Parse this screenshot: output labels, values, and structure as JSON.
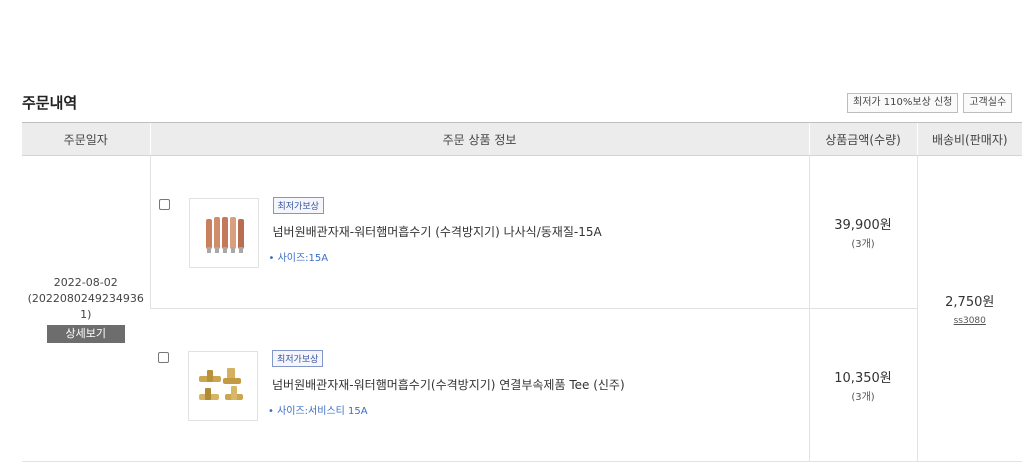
{
  "section": {
    "title": "주문내역",
    "buttons": [
      "최저가 110%보상 신청",
      "고객실수"
    ]
  },
  "table": {
    "headers": [
      "주문일자",
      "주문 상품 정보",
      "상품금액(수량)",
      "배송비(판매자)"
    ],
    "order": {
      "date": "2022-08-02",
      "order_number_line1": "(2022080249234936",
      "order_number_line2": "1)",
      "detail_label": "상세보기"
    },
    "items": [
      {
        "badge": "최저가보상",
        "name": "넘버원배관자재-워터햄머흡수기 (수격방지기) 나사식/동재질-15A",
        "option": "• 사이즈:15A",
        "price": "39,900원",
        "qty": "(3개)"
      },
      {
        "badge": "최저가보상",
        "name": "넘버원배관자재-워터햄머흡수기(수격방지기) 연결부속제품 Tee (신주)",
        "option": "• 사이즈:서비스티 15A",
        "price": "10,350원",
        "qty": "(3개)"
      }
    ],
    "shipping": {
      "fee": "2,750원",
      "seller": "ss3080"
    }
  }
}
